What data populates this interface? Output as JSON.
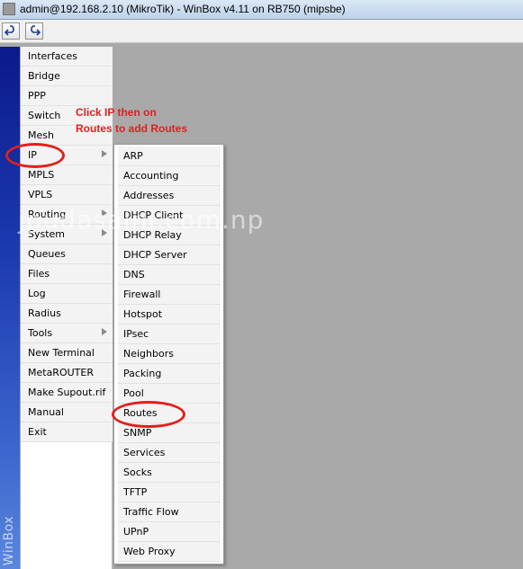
{
  "window": {
    "title": "admin@192.168.2.10 (MikroTik) - WinBox v4.11 on RB750 (mipsbe)"
  },
  "toolbar": {
    "undo_icon": "undo-icon",
    "redo_icon": "redo-icon"
  },
  "side_strip": {
    "brand": "WinBox",
    "color": "#1c3bb0"
  },
  "main_menu": {
    "items": [
      {
        "label": "Interfaces",
        "has_submenu": false
      },
      {
        "label": "Bridge",
        "has_submenu": false
      },
      {
        "label": "PPP",
        "has_submenu": false
      },
      {
        "label": "Switch",
        "has_submenu": false
      },
      {
        "label": "Mesh",
        "has_submenu": false
      },
      {
        "label": "IP",
        "has_submenu": true
      },
      {
        "label": "MPLS",
        "has_submenu": false
      },
      {
        "label": "VPLS",
        "has_submenu": false
      },
      {
        "label": "Routing",
        "has_submenu": true
      },
      {
        "label": "System",
        "has_submenu": true
      },
      {
        "label": "Queues",
        "has_submenu": false
      },
      {
        "label": "Files",
        "has_submenu": false
      },
      {
        "label": "Log",
        "has_submenu": false
      },
      {
        "label": "Radius",
        "has_submenu": false
      },
      {
        "label": "Tools",
        "has_submenu": true
      },
      {
        "label": "New Terminal",
        "has_submenu": false
      },
      {
        "label": "MetaROUTER",
        "has_submenu": false
      },
      {
        "label": "Make Supout.rif",
        "has_submenu": false
      },
      {
        "label": "Manual",
        "has_submenu": false
      },
      {
        "label": "Exit",
        "has_submenu": false
      }
    ]
  },
  "ip_submenu": {
    "items": [
      "ARP",
      "Accounting",
      "Addresses",
      "DHCP Client",
      "DHCP Relay",
      "DHCP Server",
      "DNS",
      "Firewall",
      "Hotspot",
      "IPsec",
      "Neighbors",
      "Packing",
      "Pool",
      "Routes",
      "SNMP",
      "Services",
      "Socks",
      "TFTP",
      "Traffic Flow",
      "UPnP",
      "Web Proxy"
    ]
  },
  "annotation": {
    "line1": "Click IP then on",
    "line2": "Routes to add Routes",
    "color": "#e0201c"
  },
  "watermark": {
    "text": "jpudasaini.com.np"
  }
}
